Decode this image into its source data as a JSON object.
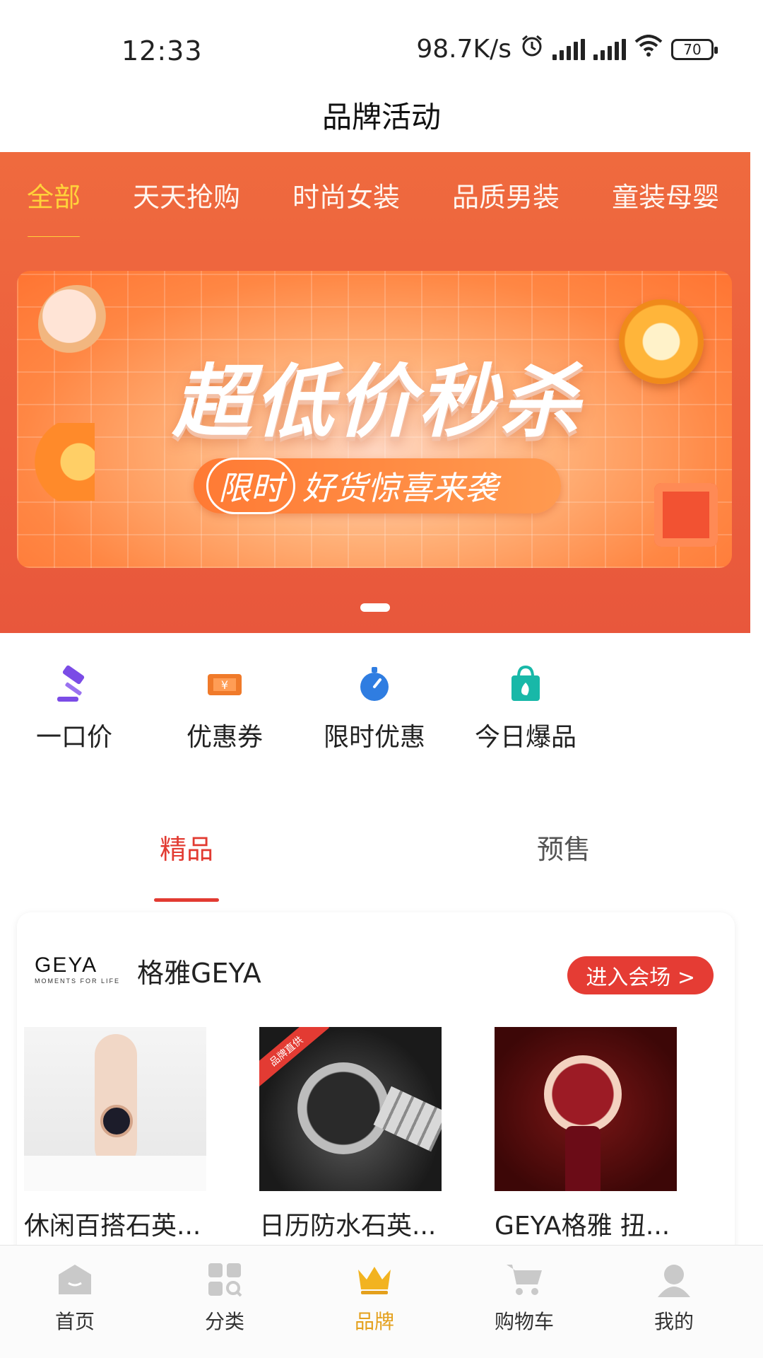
{
  "status_bar": {
    "time": "12:33",
    "network_speed": "98.7K/s",
    "battery": "70"
  },
  "header": {
    "title": "品牌活动"
  },
  "category_tabs": [
    {
      "label": "全部",
      "active": true
    },
    {
      "label": "天天抢购",
      "active": false
    },
    {
      "label": "时尚女装",
      "active": false
    },
    {
      "label": "品质男装",
      "active": false
    },
    {
      "label": "童装母婴",
      "active": false
    }
  ],
  "banner": {
    "headline": "超低价秒杀",
    "tag": "限时",
    "subline": "好货惊喜来袭"
  },
  "quick_links": [
    {
      "label": "一口价",
      "icon": "gavel-icon",
      "color": "#7b4ce6"
    },
    {
      "label": "优惠券",
      "icon": "coupon-icon",
      "color": "#f07a2a"
    },
    {
      "label": "限时优惠",
      "icon": "stopwatch-icon",
      "color": "#2f7de1"
    },
    {
      "label": "今日爆品",
      "icon": "hot-bag-icon",
      "color": "#18b8a8"
    }
  ],
  "sub_tabs": [
    {
      "label": "精品",
      "active": true
    },
    {
      "label": "预售",
      "active": false
    }
  ],
  "brand_card": {
    "logo_text": "GEYA",
    "logo_tagline": "MOMENTS FOR LIFE",
    "brand_name": "格雅GEYA",
    "enter_button": "进入会场 >",
    "products": [
      {
        "title": "休闲百搭石英..."
      },
      {
        "title": "日历防水石英...",
        "ribbon": "品牌直供"
      },
      {
        "title": "GEYA格雅 扭..."
      }
    ]
  },
  "bottom_nav": [
    {
      "label": "首页",
      "icon": "home-icon",
      "active": false
    },
    {
      "label": "分类",
      "icon": "category-icon",
      "active": false
    },
    {
      "label": "品牌",
      "icon": "crown-icon",
      "active": true
    },
    {
      "label": "购物车",
      "icon": "cart-icon",
      "active": false
    },
    {
      "label": "我的",
      "icon": "profile-icon",
      "active": false
    }
  ],
  "colors": {
    "brand_orange": "#ec5f3d",
    "active_yellow": "#ffd23a",
    "accent_red": "#e53c34",
    "nav_active": "#e4a01c"
  }
}
